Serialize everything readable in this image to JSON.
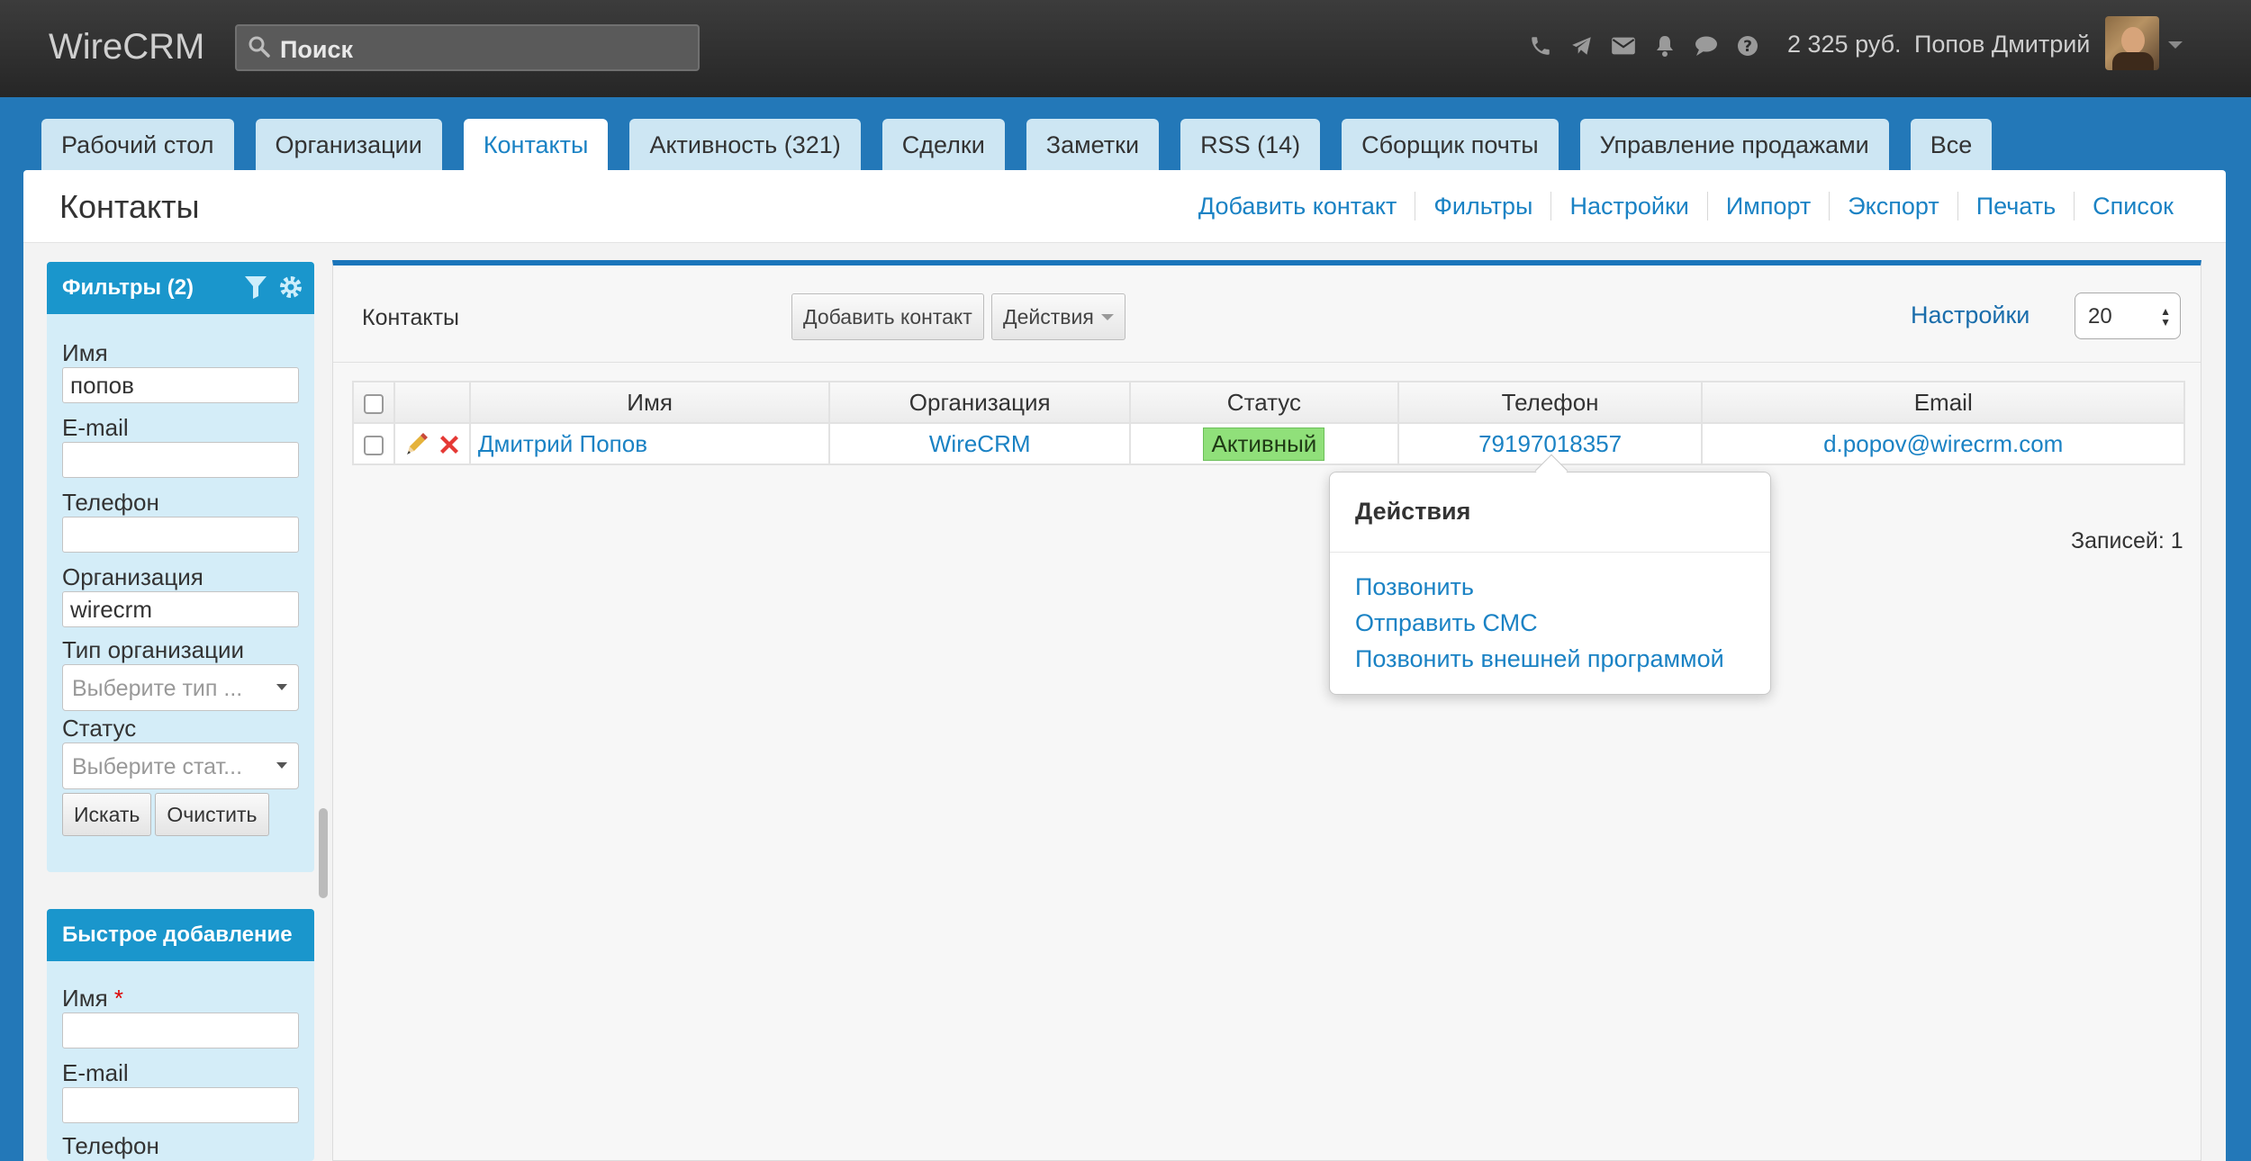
{
  "app": {
    "logo": "WireCRM"
  },
  "search": {
    "placeholder": "Поиск"
  },
  "topbar": {
    "icons": [
      "phone-icon",
      "telegram-icon",
      "mail-icon",
      "bell-icon",
      "chat-icon",
      "help-icon"
    ],
    "balance": "2 325 руб.",
    "user_name": "Попов Дмитрий"
  },
  "tabs": [
    {
      "label": "Рабочий стол",
      "active": false
    },
    {
      "label": "Организации",
      "active": false
    },
    {
      "label": "Контакты",
      "active": true
    },
    {
      "label": "Активность (321)",
      "active": false
    },
    {
      "label": "Сделки",
      "active": false
    },
    {
      "label": "Заметки",
      "active": false
    },
    {
      "label": "RSS (14)",
      "active": false
    },
    {
      "label": "Сборщик почты",
      "active": false
    },
    {
      "label": "Управление продажами",
      "active": false
    },
    {
      "label": "Все",
      "active": false
    }
  ],
  "page": {
    "title": "Контакты",
    "links": [
      "Добавить контакт",
      "Фильтры",
      "Настройки",
      "Импорт",
      "Экспорт",
      "Печать",
      "Список"
    ]
  },
  "filters": {
    "title": "Фильтры (2)",
    "name_label": "Имя",
    "name_value": "попов",
    "email_label": "E-mail",
    "email_value": "",
    "phone_label": "Телефон",
    "phone_value": "",
    "org_label": "Организация",
    "org_value": "wirecrm",
    "org_type_label": "Тип организации",
    "org_type_placeholder": "Выберите тип ...",
    "status_label": "Статус",
    "status_placeholder": "Выберите стат...",
    "search_button": "Искать",
    "clear_button": "Очистить"
  },
  "quick_add": {
    "title": "Быстрое добавление",
    "name_label": "Имя",
    "required_mark": "*",
    "email_label": "E-mail",
    "phone_label": "Телефон"
  },
  "content": {
    "title": "Контакты",
    "add_button": "Добавить контакт",
    "actions_button": "Действия",
    "settings_link": "Настройки",
    "per_page": "20",
    "records": "Записей: 1"
  },
  "table": {
    "columns": [
      "Имя",
      "Организация",
      "Статус",
      "Телефон",
      "Email"
    ],
    "rows": [
      {
        "name": "Дмитрий Попов",
        "organization": "WireCRM",
        "status": "Активный",
        "phone": "79197018357",
        "email": "d.popov@wirecrm.com"
      }
    ]
  },
  "popover": {
    "title": "Действия",
    "items": [
      "Позвонить",
      "Отправить СМС",
      "Позвонить внешней программой"
    ]
  },
  "colors": {
    "topbar": "#2b2b2b",
    "page_background": "#2378b8",
    "accent_link": "#1a82c4",
    "sidebar_header": "#1a96cc",
    "status_active": "#90e07a"
  }
}
